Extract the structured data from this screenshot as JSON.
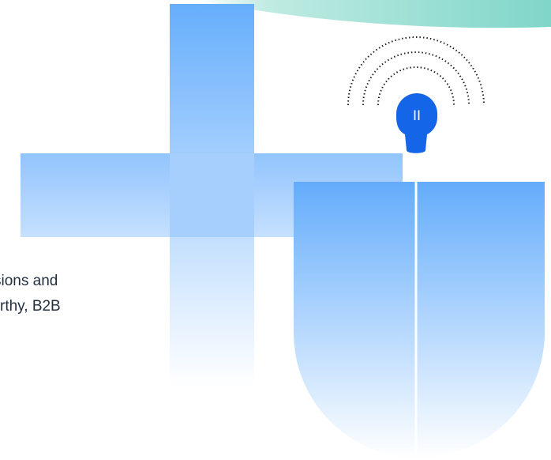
{
  "text": {
    "line1": "sions and",
    "line2": "rthy, B2B"
  },
  "icons": {
    "wave": "teal-wave-shape",
    "plus": "plus-icon",
    "shield": "shield-icon",
    "broadcast": "broadcast-icon",
    "pause_glyph": "II"
  },
  "colors": {
    "teal": "#7fd6c9",
    "blue_top": "#66aefc",
    "blue_bottom": "#ffffff",
    "broadcast_blue": "#1565e8",
    "text": "#1f2d3d"
  }
}
